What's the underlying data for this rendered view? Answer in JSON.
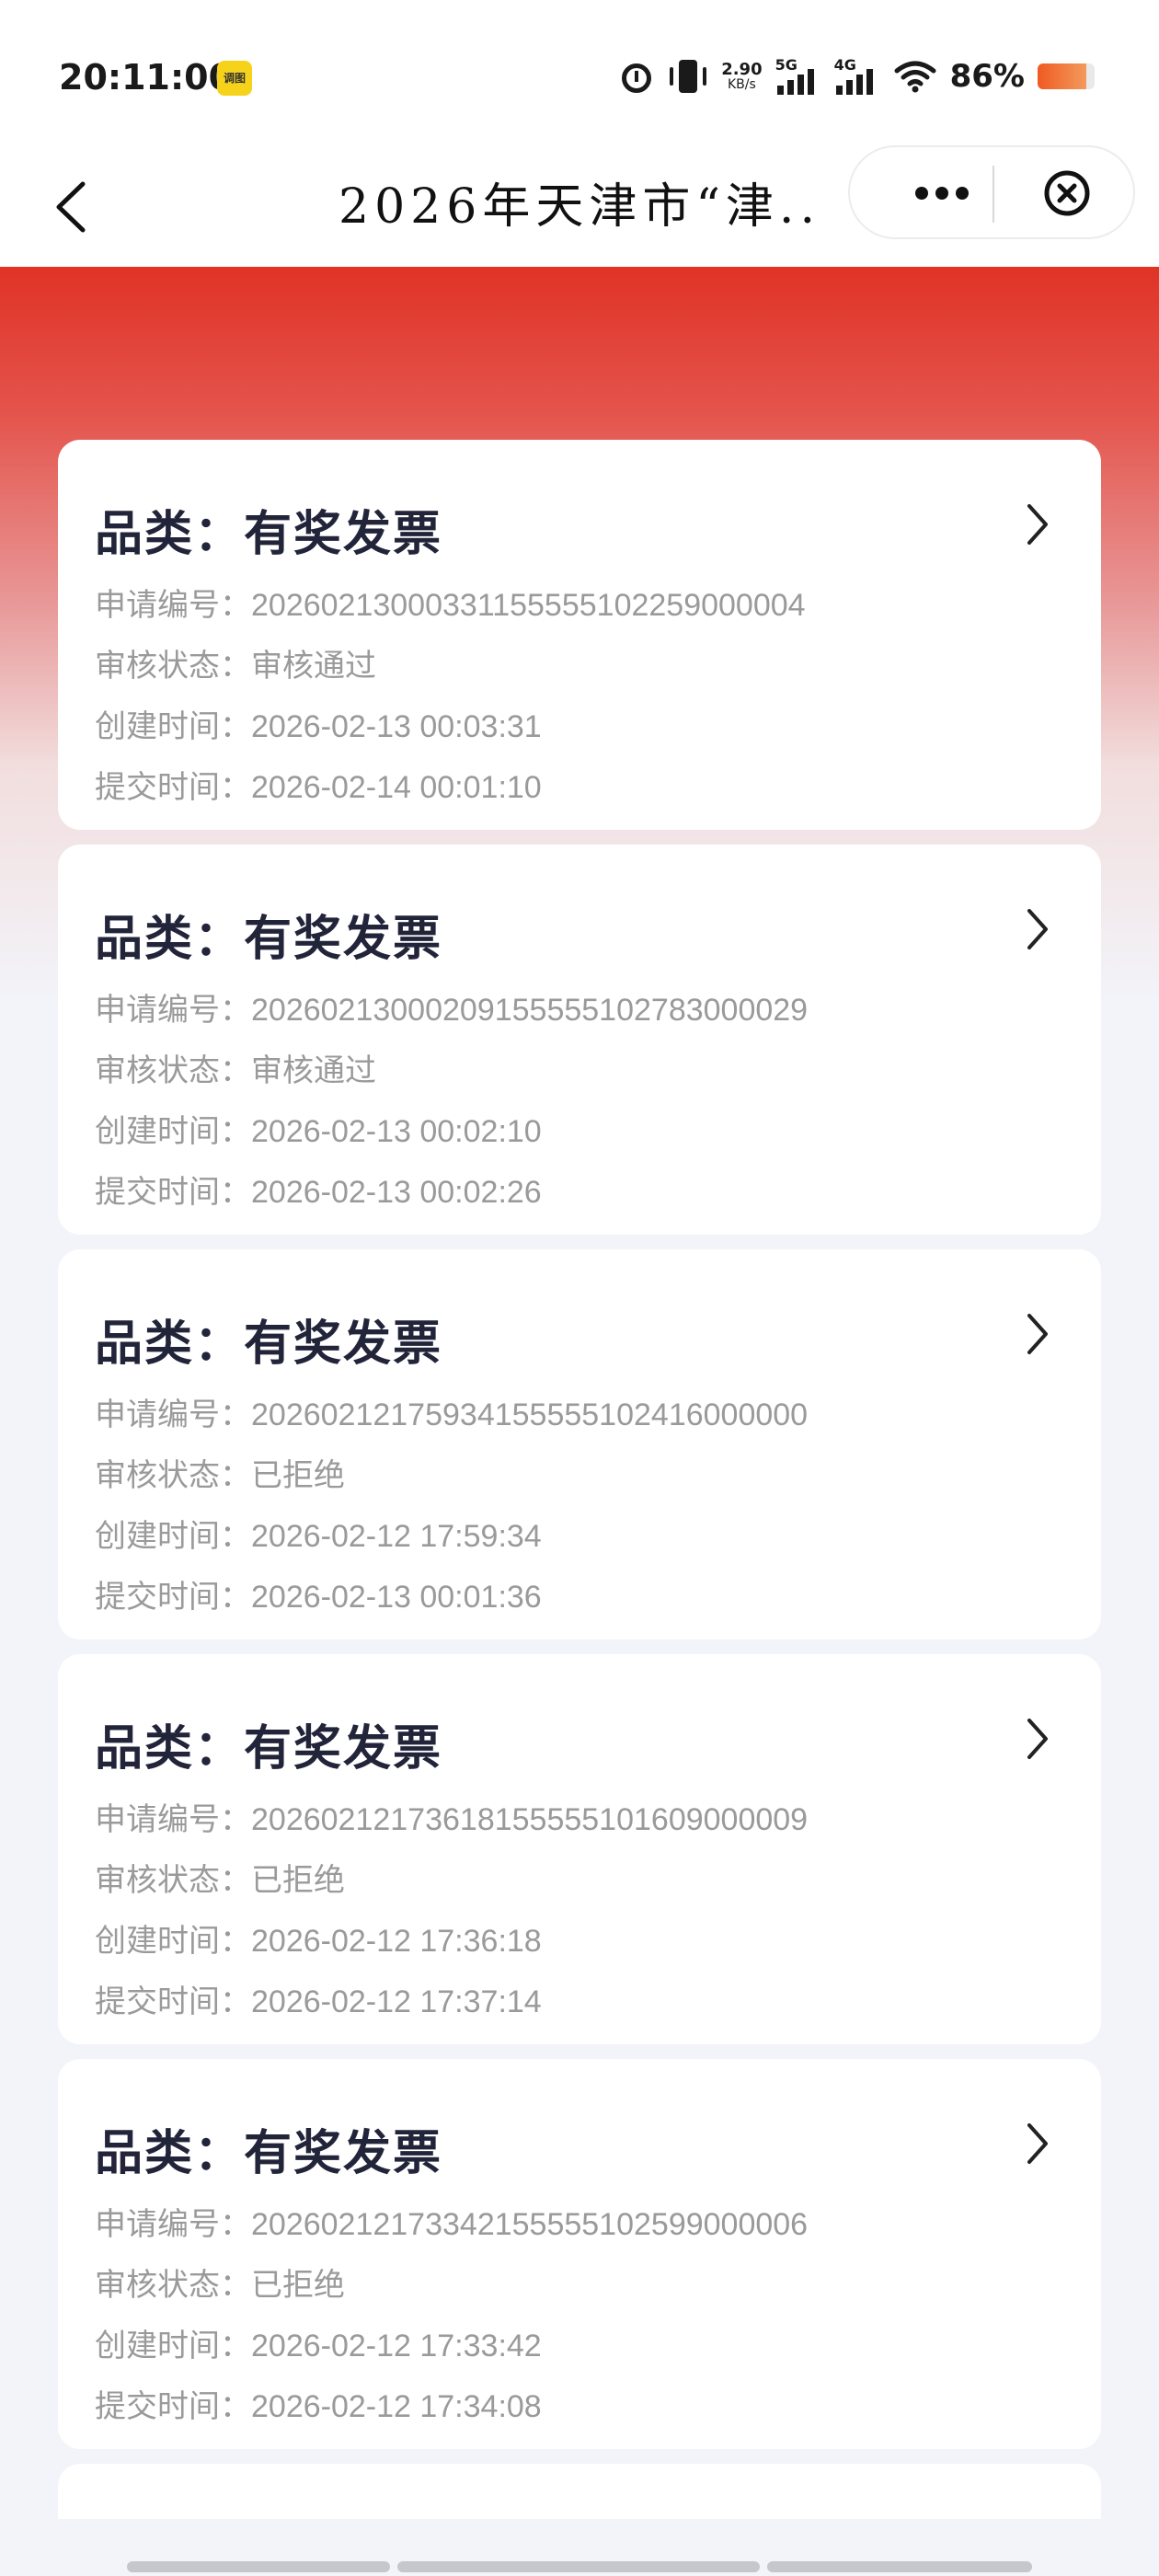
{
  "status_bar": {
    "time": "20:11:00",
    "badge": "调图",
    "speed_value": "2.90",
    "speed_unit": "KB/s",
    "signal_1_label": "5G",
    "signal_2_label": "4G",
    "battery_percent": "86%",
    "battery_level": 0.86,
    "battery_color": "#ef5a22"
  },
  "nav": {
    "title": "2026年天津市“津...",
    "back_icon": "chevron-left-icon",
    "more_icon": "more-dots-icon",
    "close_icon": "close-circle-icon"
  },
  "theme": {
    "accent": "#e03326",
    "background": "#f2f4f9",
    "card": "#ffffff"
  },
  "labels": {
    "category": "品类：",
    "application_no": "申请编号：",
    "review_status": "审核状态：",
    "created_time": "创建时间：",
    "submitted_time": "提交时间："
  },
  "records": [
    {
      "category": "有奖发票",
      "application_no": "20260213000331155555102259000004",
      "review_status": "审核通过",
      "created_time": "2026-02-13 00:03:31",
      "submitted_time": "2026-02-14 00:01:10"
    },
    {
      "category": "有奖发票",
      "application_no": "20260213000209155555102783000029",
      "review_status": "审核通过",
      "created_time": "2026-02-13 00:02:10",
      "submitted_time": "2026-02-13 00:02:26"
    },
    {
      "category": "有奖发票",
      "application_no": "20260212175934155555102416000000",
      "review_status": "已拒绝",
      "created_time": "2026-02-12 17:59:34",
      "submitted_time": "2026-02-13 00:01:36"
    },
    {
      "category": "有奖发票",
      "application_no": "20260212173618155555101609000009",
      "review_status": "已拒绝",
      "created_time": "2026-02-12 17:36:18",
      "submitted_time": "2026-02-12 17:37:14"
    },
    {
      "category": "有奖发票",
      "application_no": "20260212173342155555102599000006",
      "review_status": "已拒绝",
      "created_time": "2026-02-12 17:33:42",
      "submitted_time": "2026-02-12 17:34:08"
    }
  ]
}
